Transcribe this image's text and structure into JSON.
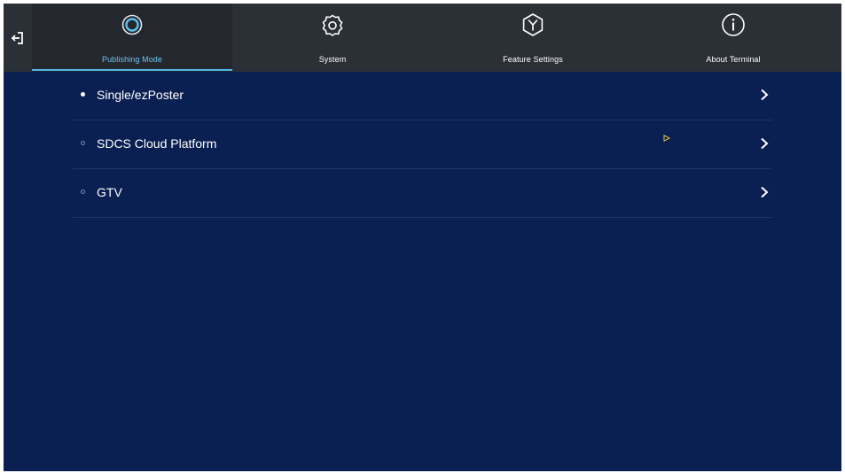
{
  "tabs": [
    {
      "label": "Publishing Mode",
      "icon": "publishing-mode-icon",
      "active": true
    },
    {
      "label": "System",
      "icon": "gear-icon",
      "active": false
    },
    {
      "label": "Feature Settings",
      "icon": "feature-settings-icon",
      "active": false
    },
    {
      "label": "About Terminal",
      "icon": "info-icon",
      "active": false
    }
  ],
  "options": [
    {
      "label": "Single/ezPoster",
      "selected": true
    },
    {
      "label": "SDCS Cloud Platform",
      "selected": false
    },
    {
      "label": "GTV",
      "selected": false
    }
  ],
  "colors": {
    "background": "#0a1f52",
    "topbar": "#2b2f36",
    "accent": "#58b6ec",
    "cursor": "#e6c84a"
  }
}
